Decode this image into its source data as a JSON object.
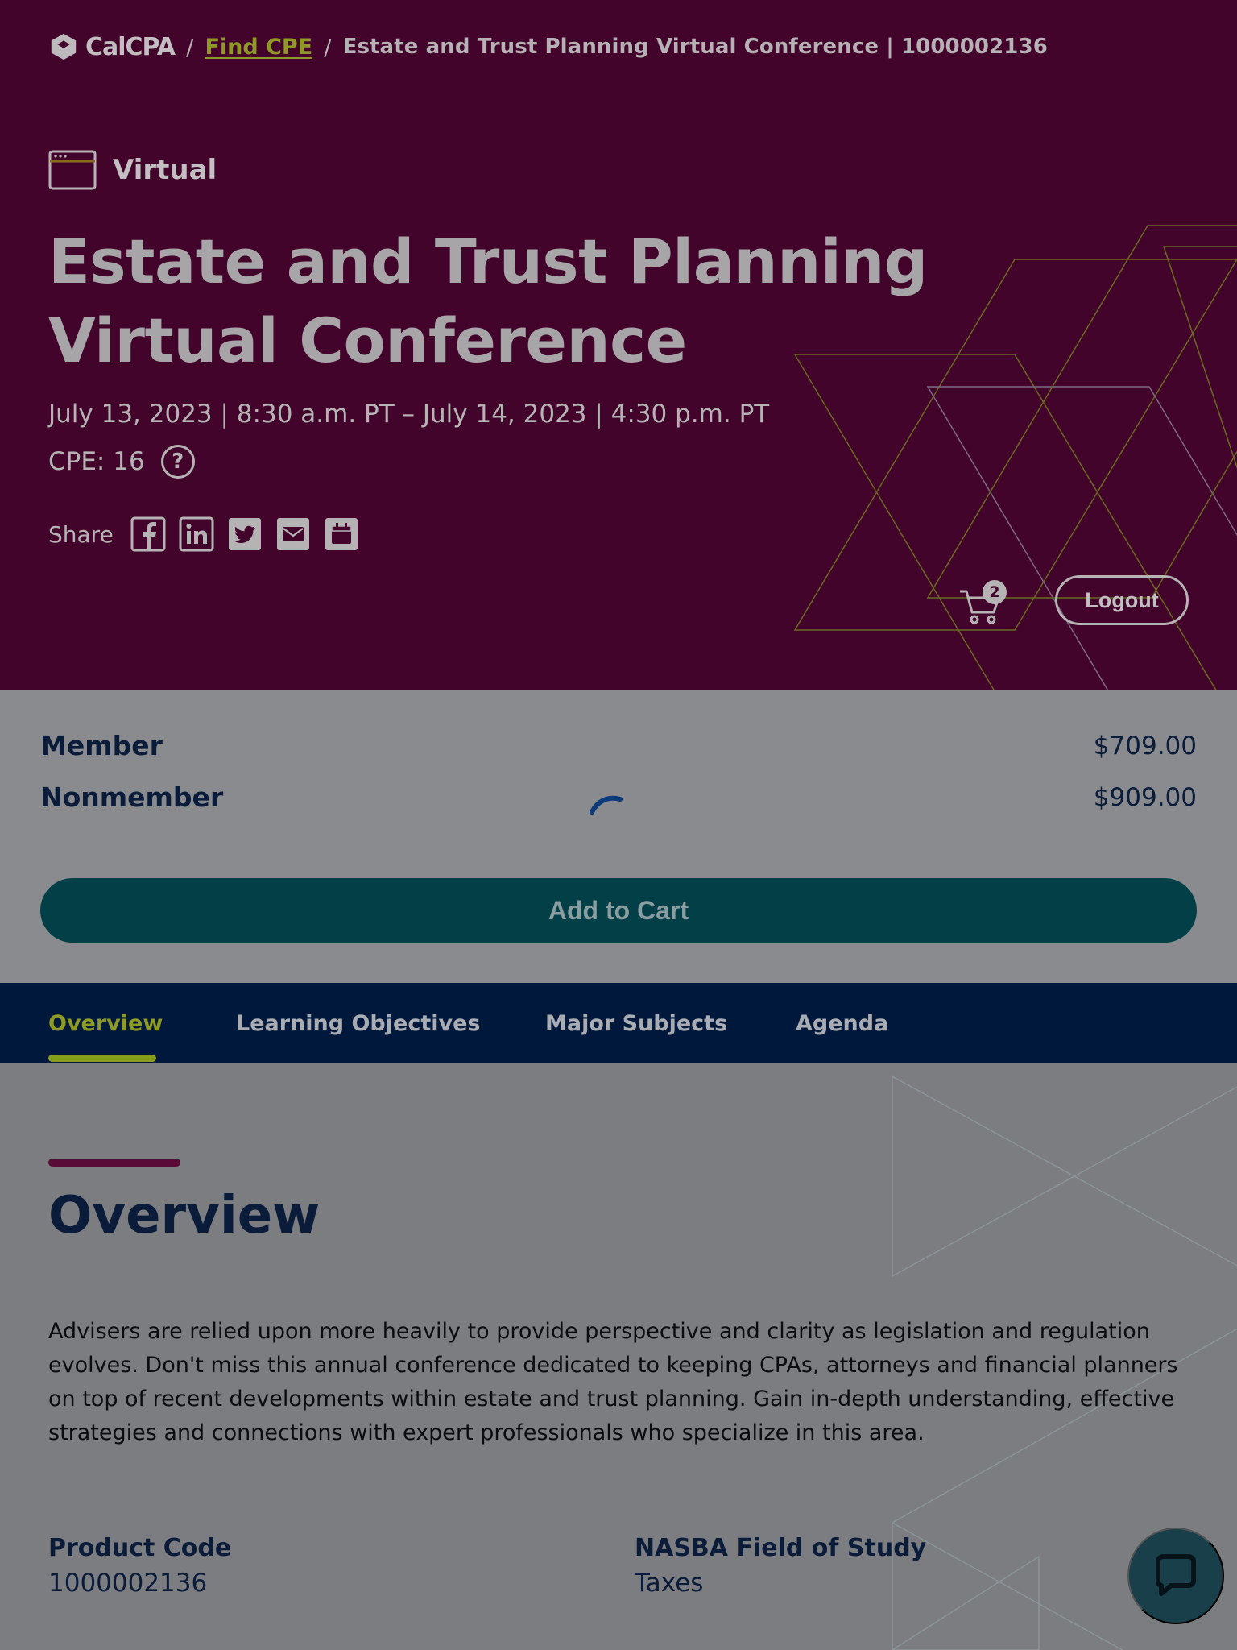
{
  "colors": {
    "hero_bg": "#42042a",
    "accent_lime": "#8d9a24",
    "navy": "#0a1c3a",
    "teal_button": "#023f46",
    "tab_bar": "#00183b"
  },
  "breadcrumb": {
    "logo_text": "CalCPA",
    "link": "Find CPE",
    "current": "Estate and Trust Planning Virtual Conference | 1000002136"
  },
  "event": {
    "format_icon": "browser-window-icon",
    "format": "Virtual",
    "title": "Estate and Trust Planning Virtual Conference",
    "dates": "July 13, 2023 | 8:30 a.m. PT – July 14, 2023 | 4:30 p.m. PT",
    "cpe": "CPE: 16",
    "help_symbol": "?"
  },
  "share": {
    "label": "Share",
    "icons": [
      "facebook-icon",
      "linkedin-icon",
      "twitter-icon",
      "email-icon",
      "calendar-icon"
    ]
  },
  "header_actions": {
    "cart_count": "2",
    "logout": "Logout"
  },
  "pricing": {
    "rows": [
      {
        "label": "Member",
        "price": "$709.00"
      },
      {
        "label": "Nonmember",
        "price": "$909.00"
      }
    ],
    "add_to_cart": "Add to Cart"
  },
  "tabs": [
    {
      "label": "Overview",
      "active": true
    },
    {
      "label": "Learning Objectives",
      "active": false
    },
    {
      "label": "Major Subjects",
      "active": false
    },
    {
      "label": "Agenda",
      "active": false
    }
  ],
  "overview": {
    "title": "Overview",
    "body": "Advisers are relied upon more heavily to provide perspective and clarity as legislation and regulation evolves. Don't miss this annual conference dedicated to keeping CPAs, attorneys and financial planners on top of recent developments within estate and trust planning. Gain in-depth understanding, effective strategies and connections with expert professionals who specialize in this area.",
    "details": [
      {
        "label": "Product Code",
        "value": "1000002136"
      },
      {
        "label": "NASBA Field of Study",
        "value": "Taxes"
      }
    ]
  }
}
